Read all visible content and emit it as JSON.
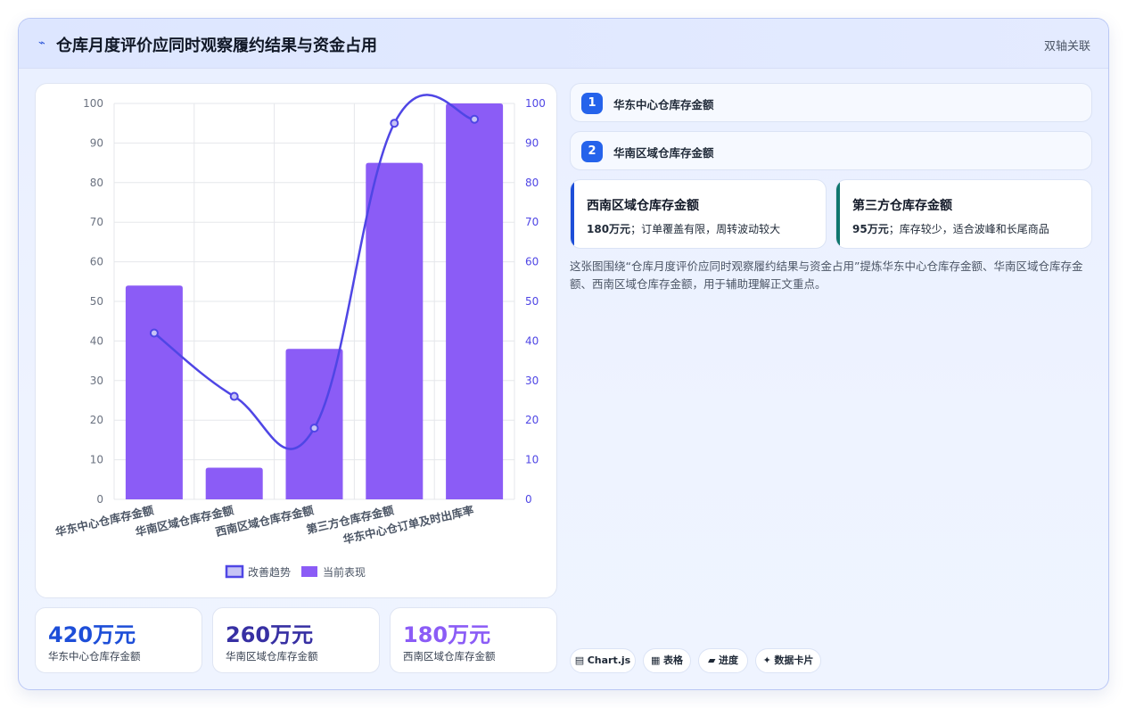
{
  "header": {
    "icon": "chart-line-icon",
    "title": "仓库月度评价应同时观察履约结果与资金占用",
    "tag": "双轴关联"
  },
  "colors": {
    "bar": "#8b5cf6",
    "line": "#4f46e5",
    "accent_blue": "#1d4ed8",
    "accent_teal": "#0f766e"
  },
  "chart_data": {
    "type": "bar",
    "categories": [
      "华东中心仓库存金额",
      "华南区域仓库存金额",
      "西南区域仓库存金额",
      "第三方仓库存金额",
      "华东中心仓订单及时出库率"
    ],
    "series": [
      {
        "name": "当前表现",
        "type": "bar",
        "axis": "left",
        "values": [
          54,
          8,
          38,
          85,
          100
        ]
      },
      {
        "name": "改善趋势",
        "type": "line",
        "axis": "right",
        "values": [
          42,
          26,
          18,
          95,
          96
        ]
      }
    ],
    "ylim": [
      0,
      100
    ],
    "y2lim": [
      0,
      100
    ],
    "yticks": [
      "0",
      "10",
      "20",
      "30",
      "40",
      "50",
      "60",
      "70",
      "80",
      "90",
      "100"
    ],
    "grid": true,
    "legend_position": "bottom",
    "legend": [
      "改善趋势",
      "当前表现"
    ]
  },
  "stats": [
    {
      "value": "420万元",
      "label": "华东中心仓库存金额",
      "color": "#1d4ed8"
    },
    {
      "value": "260万元",
      "label": "华南区域仓库存金额",
      "color": "#3730a3"
    },
    {
      "value": "180万元",
      "label": "西南区域仓库存金额",
      "color": "#8b5cf6"
    }
  ],
  "list": [
    {
      "num": "1",
      "text": "华东中心仓库存金额"
    },
    {
      "num": "2",
      "text": "华南区域仓库存金额"
    }
  ],
  "notes": [
    {
      "title": "西南区域仓库存金额",
      "value": "180万元",
      "desc": "；订单覆盖有限，周转波动较大",
      "color": "#1d4ed8"
    },
    {
      "title": "第三方仓库存金额",
      "value": "95万元",
      "desc": "；库存较少，适合波峰和长尾商品",
      "color": "#0f766e"
    }
  ],
  "description": "这张图围绕“仓库月度评价应同时观察履约结果与资金占用”提炼华东中心仓库存金额、华南区域仓库存金额、西南区域仓库存金额，用于辅助理解正文重点。",
  "chips": [
    {
      "icon": "chart-icon",
      "glyph": "▤",
      "label": "Chart.js"
    },
    {
      "icon": "table-icon",
      "glyph": "▦",
      "label": "表格"
    },
    {
      "icon": "progress-icon",
      "glyph": "▰",
      "label": "进度"
    },
    {
      "icon": "card-icon",
      "glyph": "✦",
      "label": "数据卡片"
    }
  ]
}
